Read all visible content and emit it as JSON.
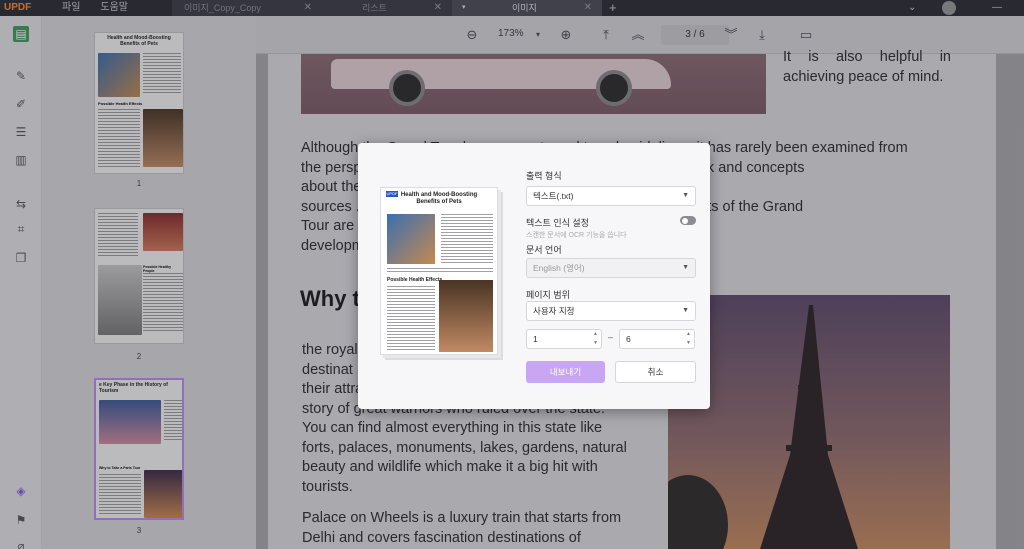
{
  "app": {
    "logo": "UPDF",
    "menu": [
      "파일",
      "도움말"
    ],
    "tabs": [
      {
        "label": "이미지_Copy_Copy",
        "active": false
      },
      {
        "label": "리스트",
        "active": false
      },
      {
        "label": "이미지",
        "active": true
      }
    ]
  },
  "toolbar": {
    "zoom": "173%",
    "page_current": "3",
    "page_total": "6"
  },
  "thumbnails": [
    {
      "number": "1",
      "title": "Health and Mood-Boosting Benefits of Pets",
      "subtitle": "Possible Health Effects"
    },
    {
      "number": "2",
      "subtitle": "Possible Healthy People"
    },
    {
      "number": "3",
      "title": "e Key Phase in the History of Tourism",
      "subtitle": "Why to Take a Paris Tour"
    }
  ],
  "document": {
    "top_right_text": "It is also helpful in achieving peace of mind.",
    "para1": "Although the Grand Tour has ... reports and travel guidelines, it has rarely been examined from the perspective ... This paper provides a review of previous work and concepts about the ... The analysis is based on an analysis of the primary sources ... of the diaries and letters of the travelers. Four aspects of the Grand Tour are examined ... the aspects of the tour, and the gradual development ...",
    "para1_lines": [
      "Although the Grand Tour has ... reports and travel guidelines, it has rarely been examined from",
      "the perspective ... This paper provides a review of previous work and concepts",
      "about the ... The analysis is based on an analysis of the primary",
      "sources ... of the diaries and letters of the travelers. Four aspects of the Grand",
      "Tour are examined ... the aspects of the tour, and the gradual",
      "development ..."
    ],
    "heading": "Why t",
    "para2_lines": [
      "the royal ...",
      "destinat ...",
      "their attractions ...",
      "story of great warriors who ruled over the state.",
      "You can find almost everything in this state like",
      "forts, palaces, monuments, lakes, gardens, natural",
      "beauty and wildlife which make it a big hit with",
      "tourists."
    ],
    "para3_lines": [
      "Palace on Wheels is a luxury train that starts from",
      "Delhi and covers fascination destinations of"
    ]
  },
  "dialog": {
    "output_format_label": "출력 형식",
    "output_format_value": "텍스트(.txt)",
    "ocr_label": "텍스트 인식 설정",
    "ocr_sub": "스캔한 문서에 OCR 기능을 씁니다",
    "ocr_enabled": false,
    "doc_lang_label": "문서 언어",
    "doc_lang_value": "English (영어)",
    "page_range_label": "페이지 범위",
    "page_range_value": "사용자 지정",
    "range_from": "1",
    "range_to": "6",
    "range_sep": "–",
    "export_label": "내보내기",
    "cancel_label": "취소",
    "preview_title": "Health and Mood-Boosting Benefits of Pets",
    "preview_subtitle": "Possible Health Effects",
    "preview_logo": "UPDF"
  },
  "colors": {
    "accent": "#c9a6f4",
    "logo": "#ff8a3d",
    "rail_active": "#3d9b5c"
  }
}
